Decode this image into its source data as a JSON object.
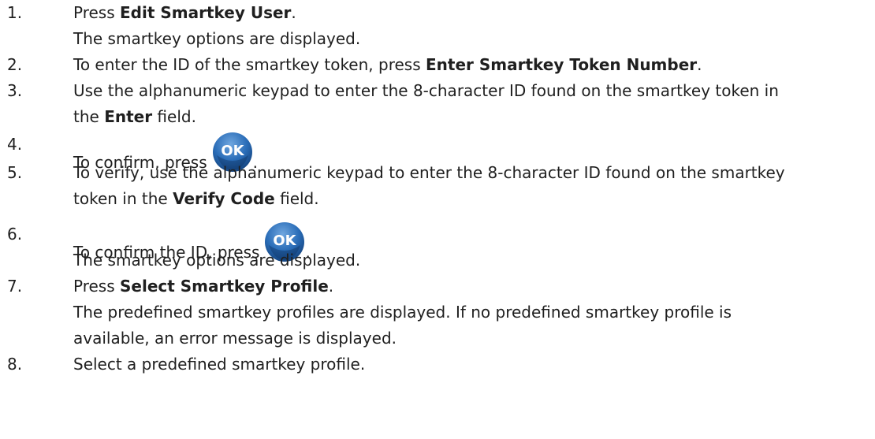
{
  "steps": [
    {
      "number": "1.",
      "pre": "Press ",
      "bold": "Edit Smartkey User",
      "post": ".",
      "result": "The smartkey options are displayed."
    },
    {
      "number": "2.",
      "pre": "To enter the ID of the smartkey token, press ",
      "bold": "Enter Smartkey Token Number",
      "post": "."
    },
    {
      "number": "3.",
      "line1": "Use the alphanumeric keypad to enter the 8-character ID found on the smartkey token in",
      "line2_pre": "the ",
      "line2_bold": "Enter",
      "line2_post": " field."
    },
    {
      "number": "4.",
      "pre": "To confirm, press",
      "post": ".",
      "icon": "ok-button-icon",
      "icon_label": "OK"
    },
    {
      "number": "5.",
      "line1": "To verify, use the alphanumeric keypad to enter the 8-character ID found on the smartkey",
      "line2_pre": "token in the ",
      "line2_bold": "Verify Code",
      "line2_post": " field."
    },
    {
      "number": "6.",
      "pre": "To confirm the ID, press",
      "post": ".",
      "icon": "ok-button-icon",
      "icon_label": "OK",
      "result": "The smartkey options are displayed."
    },
    {
      "number": "7.",
      "pre": "Press ",
      "bold": "Select Smartkey Profile",
      "post": ".",
      "result_line1": "The predefined smartkey profiles are displayed. If no predefined smartkey profile is",
      "result_line2": "available, an error message is displayed."
    },
    {
      "number": "8.",
      "text": "Select a predefined smartkey profile."
    }
  ],
  "colors": {
    "text": "#1f1f1f",
    "ok_button": "#1a5a9c"
  }
}
